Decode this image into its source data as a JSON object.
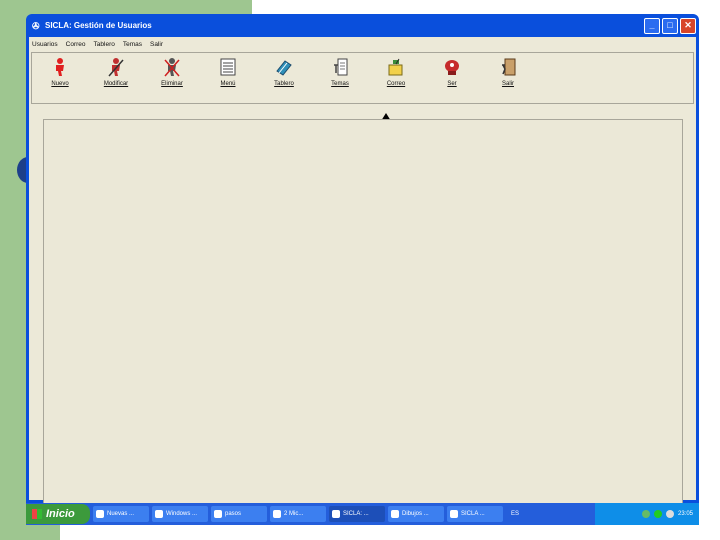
{
  "window": {
    "title": "SICLA: Gestión de Usuarios",
    "minimize": "_",
    "maximize": "□",
    "close": "✕"
  },
  "menubar": [
    "Usuarios",
    "Correo",
    "Tablero",
    "Temas",
    "Salir"
  ],
  "toolbar": [
    {
      "label": "Nuevo",
      "icon": "new-user-icon"
    },
    {
      "label": "Modificar",
      "icon": "edit-user-icon"
    },
    {
      "label": "Eliminar",
      "icon": "delete-user-icon"
    },
    {
      "label": "Menú",
      "icon": "menu-icon"
    },
    {
      "label": "Tablero",
      "icon": "board-icon"
    },
    {
      "label": "Temas",
      "icon": "topics-icon"
    },
    {
      "label": "Correo",
      "icon": "mail-icon"
    },
    {
      "label": "Ser",
      "icon": "server-icon"
    },
    {
      "label": "Salir",
      "icon": "exit-icon"
    }
  ],
  "taskbar": {
    "start": "Inicio",
    "tasks": [
      "Nuevas ...",
      "Windows ...",
      "pasos",
      "2 Mic...",
      "SICLA: ...",
      "Dibujos ...",
      "SICLA ..."
    ],
    "language": "ES",
    "clock": "23:05"
  }
}
